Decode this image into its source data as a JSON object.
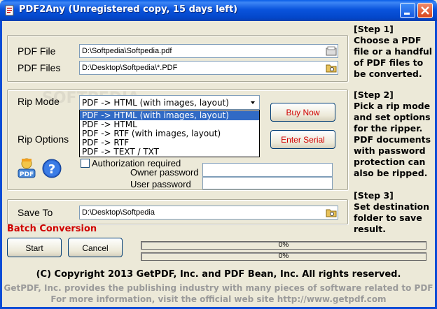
{
  "window": {
    "title": "PDF2Any (Unregistered copy, 15 days left)"
  },
  "input": {
    "pdf_file_label": "PDF File",
    "pdf_file_value": "D:\\Softpedia\\Softpedia.pdf",
    "pdf_files_label": "PDF Files",
    "pdf_files_value": "D:\\Desktop\\Softpedia\\*.PDF"
  },
  "rip": {
    "mode_label": "Rip Mode",
    "selected": "PDF -> HTML (with images, layout)",
    "options": [
      "PDF -> HTML (with images, layout)",
      "PDF -> HTML",
      "PDF -> RTF  (with images, layout)",
      "PDF -> RTF",
      "PDF -> TEXT / TXT"
    ],
    "options_label": "Rip Options",
    "authorization_label": "Authorization required",
    "owner_password_label": "Owner password",
    "user_password_label": "User password",
    "owner_password_value": "",
    "user_password_value": ""
  },
  "buttons": {
    "buy_now": "Buy Now",
    "enter_serial": "Enter Serial",
    "start": "Start",
    "cancel": "Cancel"
  },
  "save": {
    "label": "Save To",
    "value": "D:\\Desktop\\Softpedia"
  },
  "steps": {
    "step1": [
      "[Step 1]",
      "Choose a PDF",
      "file or a handful",
      "of PDF files to",
      "be converted."
    ],
    "step2": [
      "[Step 2]",
      "Pick a rip mode",
      "and set options",
      "for the ripper.",
      "PDF documents",
      "with password",
      "protection can",
      "also be ripped."
    ],
    "step3": [
      "[Step 3]",
      "Set destination",
      "folder to save",
      "result."
    ]
  },
  "batch_label": "Batch Conversion",
  "progress": {
    "bar1_text": "0%",
    "bar2_text": "0%",
    "bar1_value": 0,
    "bar2_value": 0
  },
  "footer": {
    "copyright": "(C) Copyright 2013 GetPDF, Inc. and PDF Bean, Inc.  All rights reserved.",
    "info_line1": "GetPDF, Inc. provides the publishing industry with many pieces of software related to PDF",
    "info_line2": "For more information, visit the official web site http://www.getpdf.com"
  },
  "colors": {
    "titlebar": "#0a54dd",
    "accent_red": "#d00000",
    "selection": "#316ac5"
  }
}
